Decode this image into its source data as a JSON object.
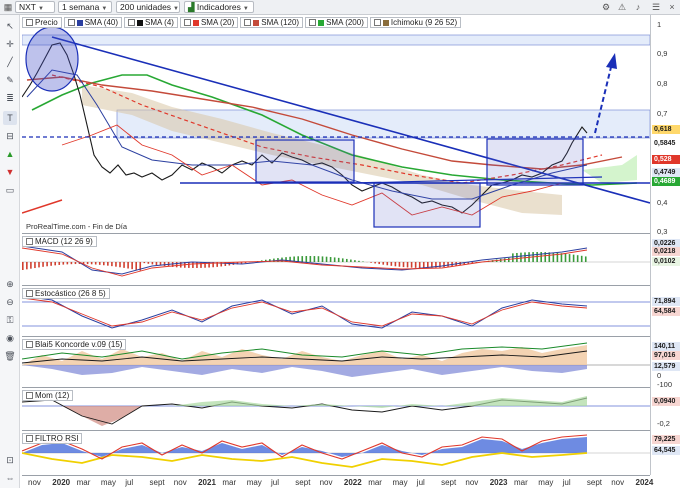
{
  "toolbar": {
    "symbol": "NXT",
    "period": "1 semana",
    "units": "200 unidades",
    "indicators": "Indicadores"
  },
  "price_panel": {
    "legend": [
      {
        "label": "Precio",
        "color": "#1f1f1f"
      },
      {
        "label": "SMA (40)",
        "color": "#2b3fa0"
      },
      {
        "label": "SMA (4)",
        "color": "#111111"
      },
      {
        "label": "SMA (20)",
        "color": "#e0372a"
      },
      {
        "label": "SMA (120)",
        "color": "#c44a3a"
      },
      {
        "label": "SMA (200)",
        "color": "#28a834"
      },
      {
        "label": "Ichimoku (9 26 52)",
        "color": "#8a6d3b"
      }
    ],
    "axis_ticks": [
      "1",
      "0,9",
      "0,8",
      "0,7",
      "0,6",
      "0,5",
      "0,4",
      "0,3"
    ],
    "tags": [
      {
        "text": "0,618",
        "color": "#1a1a1a",
        "bg": "#ffd86b"
      },
      {
        "text": "0,5845",
        "color": "#1a1a1a",
        "bg": "#ffffff"
      },
      {
        "text": "0,528",
        "color": "#ffffff",
        "bg": "#e0372a"
      },
      {
        "text": "0,4749",
        "color": "#1a1a1a",
        "bg": "#dfe7f5"
      },
      {
        "text": "0,4689",
        "color": "#ffffff",
        "bg": "#28a834"
      }
    ],
    "footer": "ProRealTime.com - Fin de Día"
  },
  "macd_panel": {
    "title": "MACD (12 26 9)",
    "tags": [
      "0,0226",
      "0,0218",
      "0,0102"
    ]
  },
  "stoch_panel": {
    "title": "Estocástico (26 8 5)",
    "tags": [
      "71,894",
      "64,584"
    ]
  },
  "blai_panel": {
    "title": "Blai5 Koncorde v.09 (15)",
    "tags": [
      "140,11",
      "97,016",
      "12,579"
    ],
    "ticks": [
      "0",
      "-100"
    ]
  },
  "mom_panel": {
    "title": "Mom (12)",
    "tags": [
      "0,0940"
    ],
    "ticks": [
      "-0,2"
    ]
  },
  "rsi_panel": {
    "title": "FILTRO RSI",
    "tags": [
      "79,225",
      "64,545"
    ]
  },
  "date_axis": [
    "nov",
    "2020",
    "mar",
    "may",
    "jul",
    "sept",
    "nov",
    "2021",
    "mar",
    "may",
    "jul",
    "sept",
    "nov",
    "2022",
    "mar",
    "may",
    "jul",
    "sept",
    "nov",
    "2023",
    "mar",
    "may",
    "jul",
    "sept",
    "nov",
    "2024"
  ],
  "colors": {
    "trendline": "#1a2fb8",
    "resistance": "#1a2fb8",
    "forecast_arrow": "#1a2fb8",
    "sma20": "#e0372a",
    "sma200": "#28a834",
    "ichimoku_cloud": "#c9b28e"
  }
}
